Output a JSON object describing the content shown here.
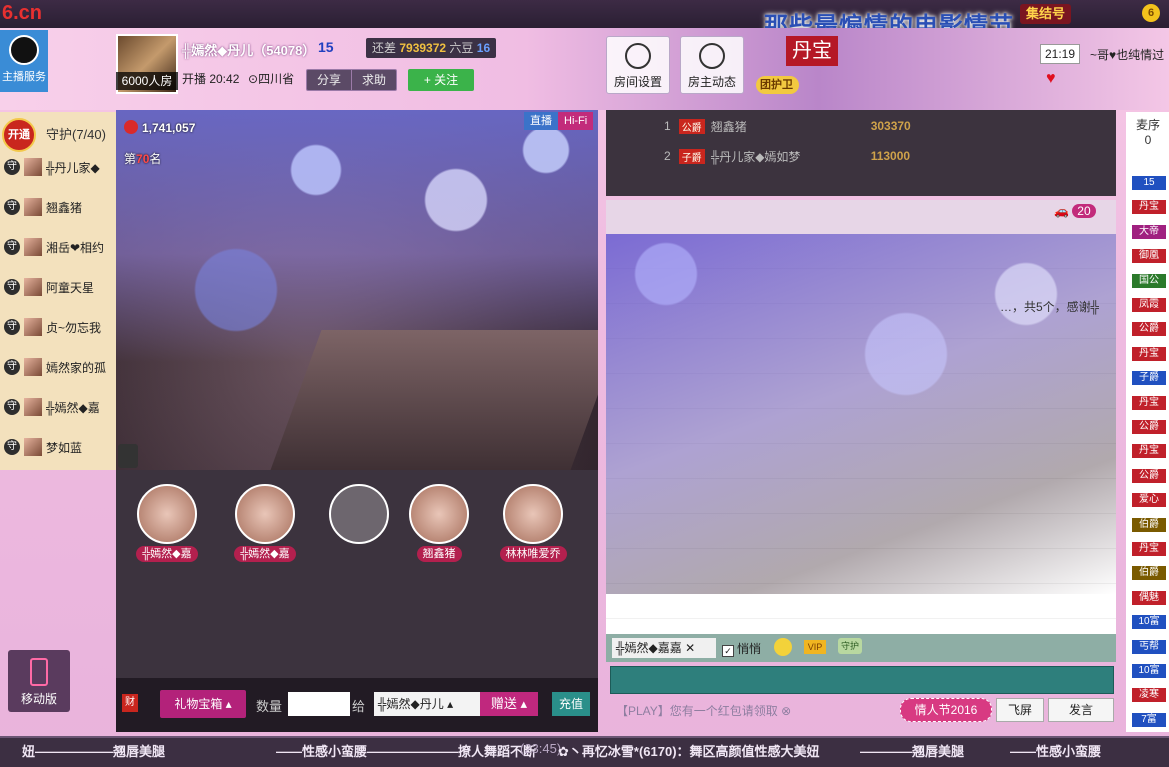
{
  "topbar": {
    "logo": "6.cn",
    "festival_title": "那些最煽情的电影情节",
    "knot_badge": "集结号",
    "coin_label": "6"
  },
  "anchor_service": {
    "label": "主播服务"
  },
  "host": {
    "name": "╬嫣然◆丹儿（54078）",
    "level": "15",
    "diff_prefix": "还差",
    "diff_value": "7939372",
    "diff_unit": "六豆",
    "next_level": "16",
    "room_size": "6000人房",
    "live_time": "开播 20:42",
    "location": "四川省",
    "share": "分享",
    "help": "求助",
    "follow": "+ 关注"
  },
  "header_buttons": {
    "room_settings": "房间设置",
    "host_feed": "房主动态"
  },
  "guard_badge": "团护卫",
  "dan_tag": "丹宝",
  "chat_clock": "21:19",
  "top_broadcast": "~哥♥也纯情过",
  "guard": {
    "open": "开通",
    "title": "守护(7/40)",
    "guard_mark": "守",
    "items": [
      {
        "name": "╬丹儿家◆"
      },
      {
        "name": "翘鑫猪"
      },
      {
        "name": "湘岳❤相约"
      },
      {
        "name": "阿童天星"
      },
      {
        "name": "贞~勿忘我"
      },
      {
        "name": "嫣然家的孤"
      },
      {
        "name": "╬嫣然◆嘉"
      },
      {
        "name": "梦如蓝"
      }
    ]
  },
  "mobile": {
    "label": "移动版"
  },
  "video": {
    "wealth": "1,741,057",
    "rank_prefix": "第",
    "rank_num": "70",
    "rank_suffix": "名",
    "live": "直播",
    "hifi": "Hi-Fi"
  },
  "seats": [
    {
      "name": "╬嫣然◆嘉"
    },
    {
      "name": "╬嫣然◆嘉"
    },
    {
      "name": ""
    },
    {
      "name": "翘鑫猪"
    },
    {
      "name": "林林唯爱乔"
    }
  ],
  "controls": {
    "wealth": "财",
    "giftbox": "礼物宝箱",
    "qty_label": "数量",
    "to_label": "给",
    "recipient": "╬嫣然◆丹儿",
    "send": "赠送",
    "recharge": "充值"
  },
  "rank_list": [
    {
      "pos": "1",
      "title": "公爵",
      "name": "翘鑫猪",
      "value": "303370"
    },
    {
      "pos": "2",
      "title": "子爵",
      "name": "╬丹儿家◆嫣如梦",
      "value": "113000"
    }
  ],
  "car_count": "20",
  "chat_message": "…，共5个，感谢╬",
  "chat_target": "╬嫣然◆嘉嘉",
  "private_label": "悄悄",
  "vip_label": "VIP",
  "guard_icon_label": "守护",
  "redpacket_notice": "【PLAY】您有一个红包请领取",
  "valentine": "情人节2016",
  "flyscreen": "飞屏",
  "send_msg": "发言",
  "audience": {
    "head_title": "麦序",
    "head_count": "0",
    "badges": [
      {
        "label": "15",
        "color": "#2050c0"
      },
      {
        "label": "丹宝",
        "color": "#c0202a"
      },
      {
        "label": "大帝",
        "color": "#a02080"
      },
      {
        "label": "御凰",
        "color": "#c0202a"
      },
      {
        "label": "国公",
        "color": "#2b7a2b"
      },
      {
        "label": "凤霞",
        "color": "#c0202a"
      },
      {
        "label": "公爵",
        "color": "#c0202a"
      },
      {
        "label": "丹宝",
        "color": "#c0202a"
      },
      {
        "label": "子爵",
        "color": "#2050c0"
      },
      {
        "label": "丹宝",
        "color": "#c0202a"
      },
      {
        "label": "公爵",
        "color": "#c0202a"
      },
      {
        "label": "丹宝",
        "color": "#c0202a"
      },
      {
        "label": "公爵",
        "color": "#c0202a"
      },
      {
        "label": "爱心",
        "color": "#c0202a"
      },
      {
        "label": "伯爵",
        "color": "#7a5a00"
      },
      {
        "label": "丹宝",
        "color": "#c0202a"
      },
      {
        "label": "伯爵",
        "color": "#7a5a00"
      },
      {
        "label": "偶魅",
        "color": "#c0202a"
      },
      {
        "label": "10富",
        "color": "#2050c0"
      },
      {
        "label": "丐帮",
        "color": "#2050c0"
      },
      {
        "label": "10富",
        "color": "#2050c0"
      },
      {
        "label": "凌寒",
        "color": "#c0202a"
      },
      {
        "label": "7富",
        "color": "#2050c0"
      }
    ]
  },
  "ticker": [
    {
      "text": "妞——————翘唇美腿",
      "gray": false
    },
    {
      "text": "——性感小蛮腰———————撩人舞蹈不断",
      "gray": false
    },
    {
      "text": "(23:45)",
      "gray": true
    },
    {
      "text": "✿丶再忆冰雪*(6170)：舞区高颜值性感大美妞",
      "gray": false
    },
    {
      "text": "————翘唇美腿",
      "gray": false
    },
    {
      "text": "——性感小蛮腰",
      "gray": false
    }
  ]
}
